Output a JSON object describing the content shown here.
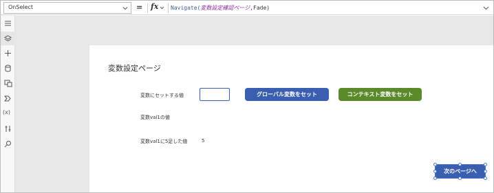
{
  "formula_bar": {
    "property": "OnSelect",
    "equals": "=",
    "fx": "fx",
    "formula_fn": "Navigate(",
    "formula_arg": "変数設定確認ページ",
    "formula_rest": ",Fade)"
  },
  "rail": {
    "items": [
      {
        "icon": "hamburger-icon"
      },
      {
        "icon": "layers-icon"
      },
      {
        "icon": "plus-icon"
      },
      {
        "icon": "data-icon"
      },
      {
        "icon": "media-icon"
      },
      {
        "icon": "flow-icon"
      },
      {
        "icon": "variables-icon",
        "label": "(x)"
      },
      {
        "icon": "tools-icon"
      },
      {
        "icon": "search-icon"
      }
    ]
  },
  "screen": {
    "title": "変数設定ページ",
    "label_set_value": "変数にセットする値",
    "label_val1": "変数val1の値",
    "label_val1_plus5": "変数val1に5足した値",
    "val1_plus5_value": "5",
    "input_value": "",
    "btn_global": "グローバル変数をセット",
    "btn_context": "コンテキスト変数をセット",
    "btn_next": "次のページへ"
  },
  "colors": {
    "primary": "#3b5fb0",
    "green": "#5a8a2a",
    "canvas": "#e7e7e7"
  }
}
